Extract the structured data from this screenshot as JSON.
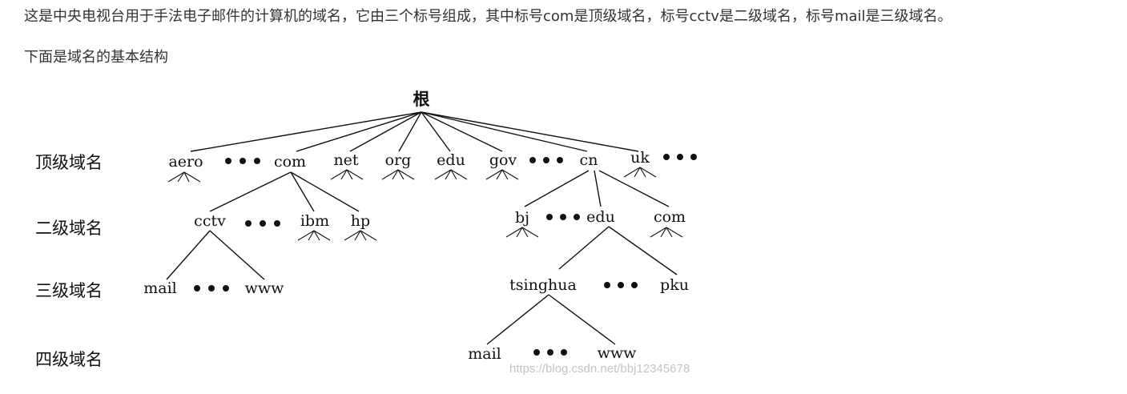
{
  "text": {
    "paragraph": "这是中央电视台用于手法电子邮件的计算机的域名，它由三个标号组成，其中标号com是顶级域名，标号cctv是二级域名，标号mail是三级域名。",
    "subtitle": "下面是域名的基本结构"
  },
  "diagram": {
    "root": "根",
    "levels": [
      "顶级域名",
      "二级域名",
      "三级域名",
      "四级域名"
    ],
    "top_level": [
      "aero",
      "com",
      "net",
      "org",
      "edu",
      "gov",
      "cn",
      "uk"
    ],
    "com_children": [
      "cctv",
      "ibm",
      "hp"
    ],
    "cn_children": [
      "bj",
      "edu",
      "com"
    ],
    "cctv_children": [
      "mail",
      "www"
    ],
    "edu_children": [
      "tsinghua",
      "pku"
    ],
    "tsinghua_children": [
      "mail",
      "www"
    ],
    "watermark": "https://blog.csdn.net/bbj12345678"
  }
}
